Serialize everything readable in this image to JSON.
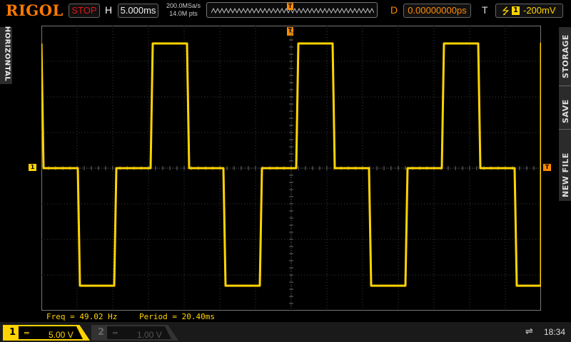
{
  "brand": "RIGOL",
  "run_state": "STOP",
  "horizontal": {
    "label": "H",
    "timebase": "5.000ms"
  },
  "acquisition": {
    "sample_rate": "200.0MSa/s",
    "memory_depth": "14.0M pts"
  },
  "trigger_position_marker": "T",
  "delay": {
    "label": "D",
    "value": "0.00000000ps"
  },
  "trigger": {
    "label": "T",
    "source": "1",
    "level": "-200mV",
    "edge_icon": "rising-edge-icon"
  },
  "left_menu": {
    "label": "HORIZONTAL"
  },
  "right_menu": {
    "items": [
      "STORAGE",
      "SAVE",
      "NEW FILE"
    ]
  },
  "markers": {
    "channel1": "1",
    "trigger": "T"
  },
  "measurements": {
    "freq": "Freq = 49.02 Hz",
    "period": "Period = 20.40ms"
  },
  "channels": [
    {
      "number": "1",
      "coupling": "═",
      "scale": "5.00 V",
      "active": true,
      "color": "#ffd400"
    },
    {
      "number": "2",
      "coupling": "═",
      "scale": "1.00 V",
      "active": false,
      "color": "#555555"
    }
  ],
  "status": {
    "usb_icon": "usb-icon",
    "time": "18:34"
  },
  "colors": {
    "trace": "#ffd400",
    "trigger": "#ff8a00",
    "stop": "#e01515"
  },
  "waveform": {
    "type": "square",
    "frequency_hz": 49.02,
    "period_ms": 20.4,
    "timebase_ms_per_div": 5.0,
    "volts_per_div": 5.0,
    "trigger_level_v": -0.2,
    "levels_v": [
      17.5,
      0,
      -16.5
    ]
  }
}
